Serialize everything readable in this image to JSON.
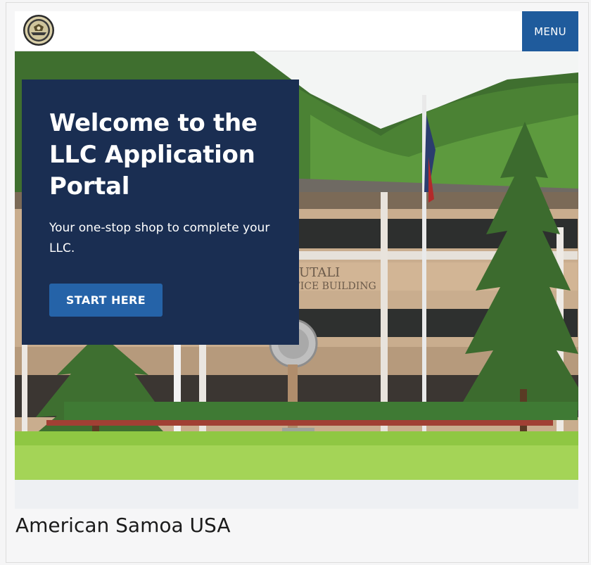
{
  "header": {
    "logo_icon": "seal-icon",
    "menu_label": "MENU"
  },
  "hero": {
    "title": "Welcome to the LLC Application Portal",
    "subtitle": "Your one-stop shop to complete your LLC.",
    "cta_label": "START HERE",
    "building_sign_line1": "UTALI",
    "building_sign_line2": "FICE BUILDING"
  },
  "footer": {
    "title": "American Samoa USA"
  },
  "colors": {
    "panel": "#1a2e52",
    "button": "#2563a8",
    "menu": "#1f5b9c"
  }
}
